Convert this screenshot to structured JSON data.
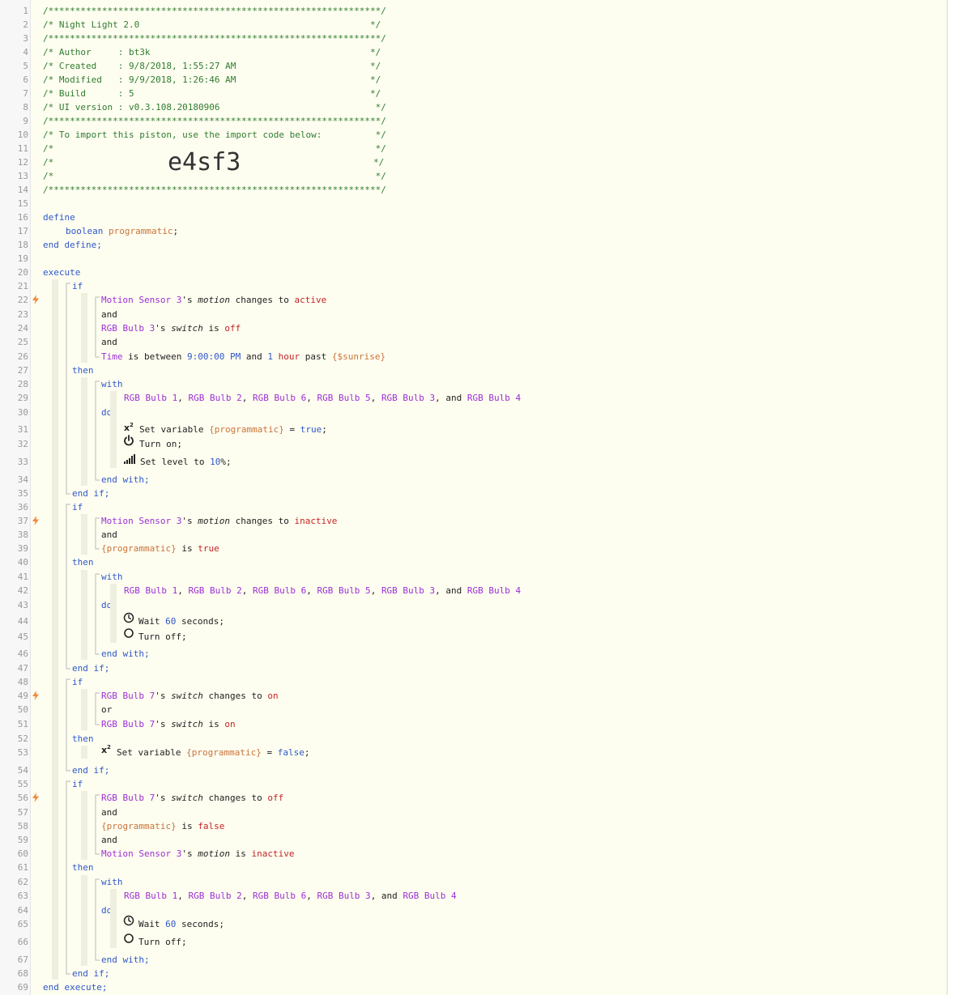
{
  "header": {
    "border": "/**************************************************************/",
    "title_line": "/* Night Light 2.0                                           */",
    "author_line": "/* Author     : bt3k                                         */",
    "created_line": "/* Created    : 9/8/2018, 1:55:27 AM                         */",
    "modified_line": "/* Modified   : 9/9/2018, 1:26:46 AM                         */",
    "build_line": "/* Build      : 5                                            */",
    "ui_line": "/* UI version : v0.3.108.20180906                             */",
    "import_line": "/* To import this piston, use the import code below:          */",
    "empty_line": "/*                                                            */",
    "code_line_left": "/*",
    "code_line_right": "*/",
    "import_code": "e4sf3"
  },
  "keywords": {
    "define": "define",
    "end_define": "end define;",
    "execute": "execute",
    "end_execute": "end execute;",
    "if": "if",
    "then": "then",
    "end_if": "end if;",
    "with": "with",
    "do": "do",
    "end_with": "end with;",
    "and": "and",
    "or": "or",
    "is": "is",
    "changes_to": "changes to",
    "is_between": "is between",
    "boolean": "boolean",
    "semicolon": ";",
    "equals": " = ",
    "possessive": "'s"
  },
  "variables": {
    "programmatic": "programmatic",
    "programmatic_ref": "{programmatic}",
    "sunrise": "{$sunrise}"
  },
  "devices": {
    "motion3": "Motion Sensor 3",
    "bulb1": "RGB Bulb 1",
    "bulb2": "RGB Bulb 2",
    "bulb3": "RGB Bulb 3",
    "bulb4": "RGB Bulb 4",
    "bulb5": "RGB Bulb 5",
    "bulb6": "RGB Bulb 6",
    "bulb7": "RGB Bulb 7",
    "time": "Time",
    "sep_comma": ", ",
    "sep_and": ", and "
  },
  "attributes": {
    "motion": "motion",
    "switch": "switch"
  },
  "values": {
    "active": "active",
    "inactive": "inactive",
    "off": "off",
    "on": "on",
    "true": "true",
    "false": "false",
    "time_start": "9:00:00 PM",
    "one": "1",
    "hour": "hour",
    "past": "past",
    "ten": "10",
    "sixty": "60"
  },
  "actions": {
    "set_variable": "Set variable",
    "turn_on": "Turn on;",
    "turn_off": "Turn off;",
    "set_level": "Set level to",
    "percent": "%;",
    "wait": "Wait",
    "seconds": "seconds;"
  },
  "line_numbers": [
    "1",
    "2",
    "3",
    "4",
    "5",
    "6",
    "7",
    "8",
    "9",
    "10",
    "11",
    "12",
    "13",
    "14",
    "15",
    "16",
    "17",
    "18",
    "19",
    "20",
    "21",
    "22",
    "23",
    "24",
    "25",
    "26",
    "27",
    "28",
    "29",
    "30",
    "31",
    "32",
    "33",
    "34",
    "35",
    "36",
    "37",
    "38",
    "39",
    "40",
    "41",
    "42",
    "43",
    "44",
    "45",
    "46",
    "47",
    "48",
    "49",
    "50",
    "51",
    "52",
    "53",
    "54",
    "55",
    "56",
    "57",
    "58",
    "59",
    "60",
    "61",
    "62",
    "63",
    "64",
    "65",
    "66",
    "67",
    "68",
    "69"
  ],
  "colors": {
    "comment": "#2f7c2f",
    "keyword": "#2f57c8",
    "device": "#9a2fd6",
    "value": "#c42424",
    "variable": "#c9733a",
    "trigger_bolt": "#f08a3c"
  }
}
